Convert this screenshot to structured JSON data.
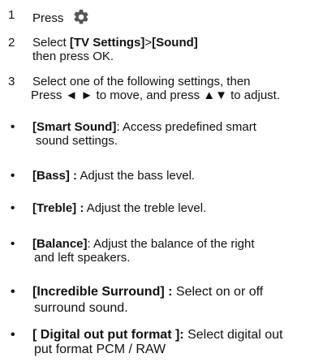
{
  "steps": [
    {
      "num": "1",
      "text": "Press"
    },
    {
      "num": "2",
      "prefix": "Select ",
      "bold1": "[TV Settings]",
      "mid": ">",
      "bold2": "[Sound]",
      "line2": "then press OK."
    },
    {
      "num": "3",
      "line1": "Select one of the following settings, then",
      "line2": "Press ◄ ► to move, and press  ▲▼  to adjust."
    }
  ],
  "bullets": [
    {
      "mark": "•",
      "term": "[Smart Sound]",
      "desc": ": Access predefined smart",
      "line2": "sound settings."
    },
    {
      "mark": "•",
      "term": "[Bass] :",
      "desc": " Adjust the bass level."
    },
    {
      "mark": "•",
      "term": "[Treble] :",
      "desc": "  Adjust the treble level."
    },
    {
      "mark": "•",
      "term": "[Balance]",
      "desc": ": Adjust the balance of the right",
      "line2": "and left speakers."
    },
    {
      "mark": "•",
      "term": "[Incredible Surround] :",
      "desc": " Select on or off",
      "line2": "surround sound."
    },
    {
      "mark": "•",
      "term": "[ Digital out put format ]:",
      "desc": " Select digital out",
      "line2": "put format PCM / RAW"
    }
  ],
  "icons": {
    "settings": "gear-icon"
  }
}
